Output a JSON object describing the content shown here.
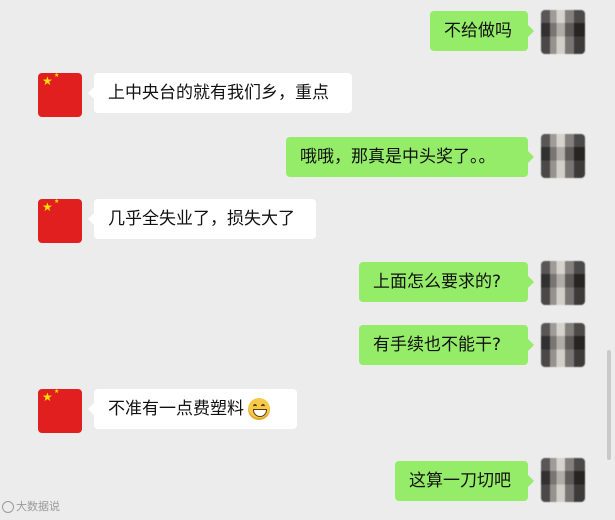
{
  "messages": [
    {
      "side": "out",
      "text": "不给做吗",
      "avatar": "person-photo"
    },
    {
      "side": "in",
      "text": "上中央台的就有我们乡，重点",
      "avatar": "china-flag"
    },
    {
      "side": "out",
      "text": "哦哦，那真是中头奖了。。",
      "avatar": "person-photo"
    },
    {
      "side": "in",
      "text": "几乎全失业了，损失大了",
      "avatar": "china-flag"
    },
    {
      "side": "out",
      "text": "上面怎么要求的?",
      "avatar": "person-photo"
    },
    {
      "side": "out",
      "text": "有手续也不能干?",
      "avatar": "person-photo"
    },
    {
      "side": "in",
      "text": "不准有一点费塑料",
      "emoji": "grinning-face",
      "avatar": "china-flag"
    },
    {
      "side": "out",
      "text": "这算一刀切吧",
      "avatar": "person-photo"
    }
  ],
  "watermark": "大数据说",
  "colors": {
    "background": "#ececec",
    "incoming_bubble": "#ffffff",
    "outgoing_bubble": "#95ec69",
    "flag_red": "#e11f1f"
  }
}
